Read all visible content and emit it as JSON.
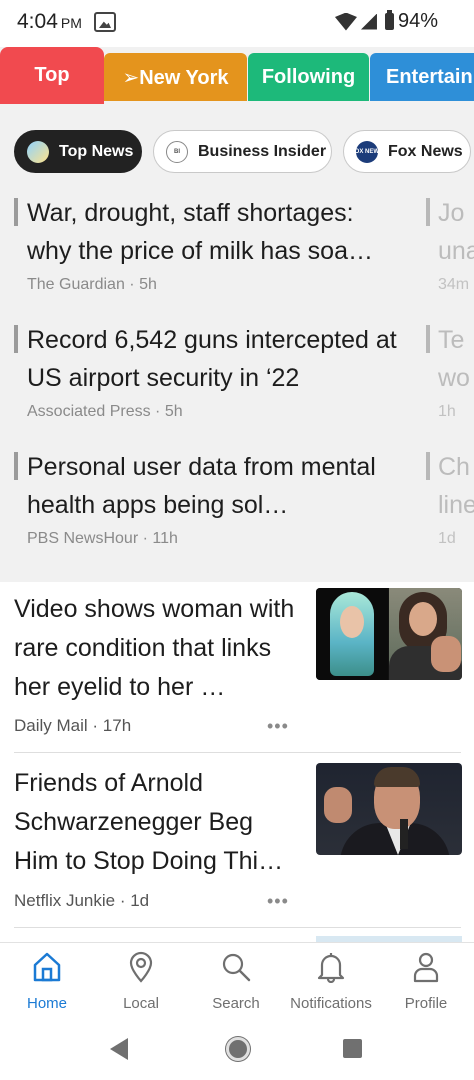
{
  "status_bar": {
    "time": "4:04",
    "ampm": "PM",
    "battery": "94%"
  },
  "section_tabs": [
    {
      "label": "Top",
      "color": "#f14a4f"
    },
    {
      "label": "➢New York",
      "color": "#e4941d"
    },
    {
      "label": "Following",
      "color": "#1db97a"
    },
    {
      "label": "Entertain",
      "color": "#2e8fd8"
    }
  ],
  "source_chips": [
    {
      "label": "Top News",
      "icon": "top-news-icon"
    },
    {
      "label": "Business Insider",
      "icon": "business-insider-icon"
    },
    {
      "label": "Fox News",
      "icon": "fox-news-icon",
      "logo_text": "FOX NEWS"
    }
  ],
  "top_headlines": [
    {
      "title": "War, drought, staff shortages: why the price of milk has soa…",
      "source": "The Guardian",
      "time": "5h"
    },
    {
      "title": "Record 6,542 guns intercepted at US airport security in ‘22",
      "source": "Associated Press",
      "time": "5h"
    },
    {
      "title": "Personal user data from mental health apps being sol…",
      "source": "PBS NewsHour",
      "time": "11h"
    }
  ],
  "peek_headlines": [
    {
      "line1": "Jo",
      "line2": "una",
      "time": "34m"
    },
    {
      "line1": "Te",
      "line2": "wo",
      "time": "1h"
    },
    {
      "line1": "Ch",
      "line2": "line",
      "time": "1d"
    }
  ],
  "articles": [
    {
      "title": "Video shows woman with rare condition that links her eyelid to her …",
      "source": "Daily Mail",
      "time": "17h",
      "more": "•••"
    },
    {
      "title": "Friends of Arnold Schwarzenegger Beg Him to Stop Doing Thi…",
      "source": "Netflix Junkie",
      "time": "1d",
      "more": "•••"
    }
  ],
  "bottom_nav": [
    {
      "label": "Home",
      "icon": "home-icon",
      "active": true
    },
    {
      "label": "Local",
      "icon": "location-pin-icon"
    },
    {
      "label": "Search",
      "icon": "search-icon"
    },
    {
      "label": "Notifications",
      "icon": "bell-icon"
    },
    {
      "label": "Profile",
      "icon": "person-icon"
    }
  ],
  "colors": {
    "accent": "#1b7ad4",
    "chip_selected": "#222222",
    "muted_text": "#8a8a8a"
  }
}
